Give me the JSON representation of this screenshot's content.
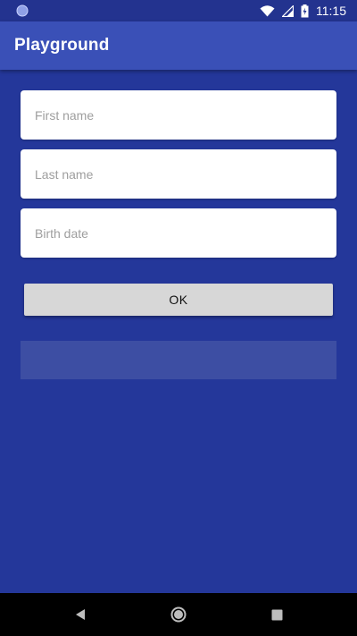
{
  "status_bar": {
    "time": "11:15",
    "icons": [
      "notification-circle-icon",
      "wifi-icon",
      "signal-icon",
      "battery-charging-icon"
    ]
  },
  "app_bar": {
    "title": "Playground"
  },
  "form": {
    "first_name": {
      "placeholder": "First name",
      "value": ""
    },
    "last_name": {
      "placeholder": "Last name",
      "value": ""
    },
    "birth_date": {
      "placeholder": "Birth date",
      "value": ""
    },
    "ok_label": "OK"
  },
  "result": {
    "text": ""
  },
  "nav_bar": {
    "buttons": [
      "back-icon",
      "home-icon",
      "recents-icon"
    ]
  },
  "colors": {
    "background": "#24379a",
    "app_bar": "#3a50b7",
    "status_bar": "#23338f",
    "button": "#d7d7d7",
    "result_panel": "#3d4ea3"
  }
}
